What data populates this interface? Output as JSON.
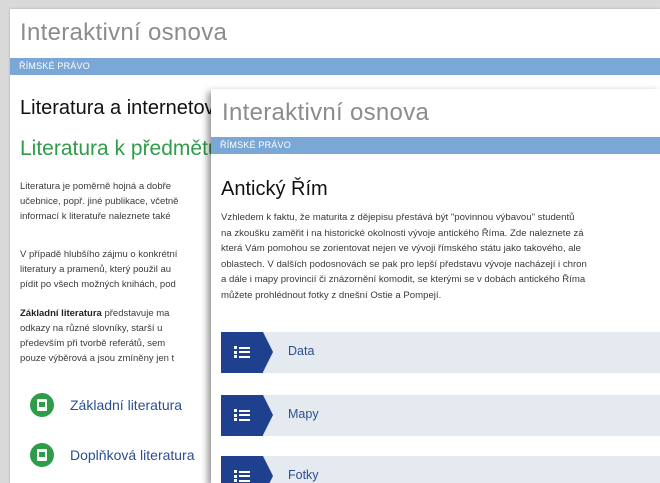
{
  "back_window": {
    "app_title": "Interaktivní osnova",
    "breadcrumb": "ŘÍMSKÉ PRÁVO",
    "heading": "Literatura a internetové zdroje",
    "subheading": "Literatura k předmětu",
    "para1": [
      "Literatura je poměrně hojná a dobře",
      "učebnice, popř. jiné publikace, včetně",
      "informací k literatuře naleznete také"
    ],
    "para2": [
      "V případě hlubšího zájmu o konkrétní",
      "literatury a pramenů, který použil au",
      "pídit po všech možných knihách, pod"
    ],
    "para3_bold": "Základní literatura",
    "para3_first_rest": " představuje ma",
    "para3": [
      "odkazy na různé slovníky, starší u",
      "především při tvorbě referátů, sem",
      "pouze výběrová a jsou zmíněny jen t"
    ],
    "links": [
      {
        "label": "Základní literatura",
        "icon": "document-icon"
      },
      {
        "label": "Doplňková literatura",
        "icon": "document-icon"
      }
    ]
  },
  "front_window": {
    "app_title": "Interaktivní osnova",
    "breadcrumb": "ŘÍMSKÉ PRÁVO",
    "heading": "Antický Řím",
    "para": [
      "Vzhledem k faktu, že maturita z dějepisu přestává být \"povinnou výbavou\" studentů",
      "na zkoušku zaměřit i na historické okolnosti vývoje antického Říma. Zde naleznete zá",
      "která Vám pomohou se zorientovat nejen ve vývoji římského státu jako takového, ale",
      "oblastech. V dalších podosnovách se pak pro lepší představu vývoje nacházejí i chron",
      "a dále i mapy provincií či znázornění komodit, se kterými se v dobách antického Říma",
      "můžete prohlédnout fotky z dnešní Ostie a Pompejí."
    ],
    "menu": [
      {
        "label": "Data",
        "icon": "list-icon"
      },
      {
        "label": "Mapy",
        "icon": "list-icon"
      },
      {
        "label": "Fotky",
        "icon": "list-icon"
      }
    ]
  },
  "colors": {
    "breadcrumb_bar": "#7aa7d6",
    "heading_green": "#2f9c4a",
    "menu_icon_bg": "#1f3f8f",
    "menu_bg": "#e5eaf0",
    "link_text": "#2c4f8f"
  }
}
